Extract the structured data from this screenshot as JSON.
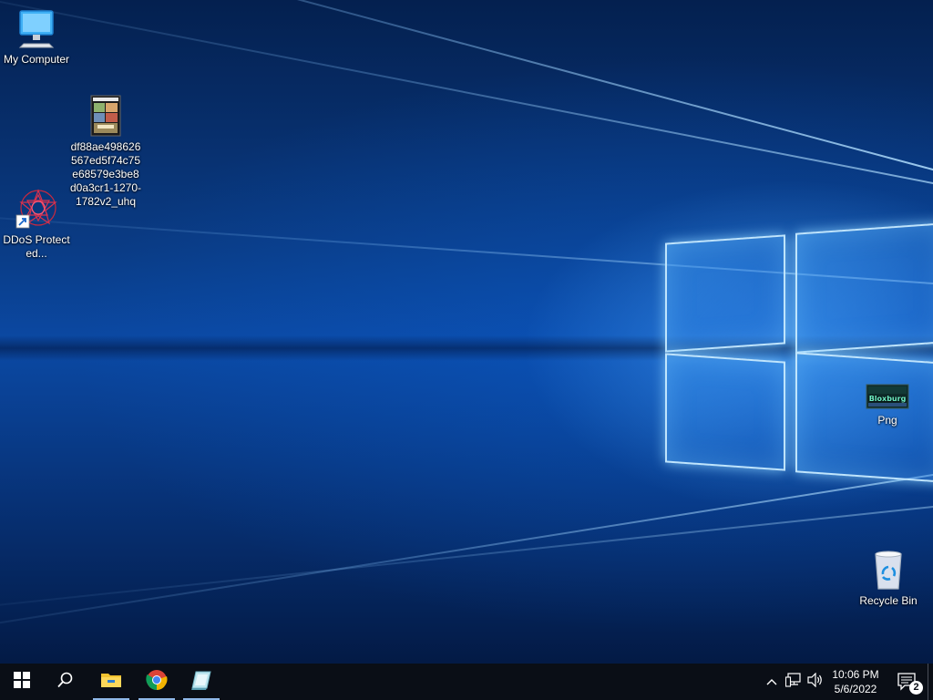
{
  "desktop": {
    "icons": {
      "my_computer": {
        "label": "My Computer",
        "icon": "monitor-icon"
      },
      "gta_file": {
        "label": "df88ae498626567ed5f74c75e68579e3be8d0a3cr1-1270-1782v2_uhq",
        "icon": "image-file-icon",
        "thumb_text": "PlayStation 2"
      },
      "ddos": {
        "label": "DDoS Protected...",
        "icon": "shortcut-app-icon"
      },
      "png": {
        "label": "Png",
        "icon": "image-file-icon",
        "thumb_text": "Bloxburg"
      },
      "recycle_bin": {
        "label": "Recycle Bin",
        "icon": "recycle-bin-icon"
      }
    }
  },
  "taskbar": {
    "start_icon": "windows-logo-icon",
    "search_icon": "search-icon",
    "pinned": [
      {
        "name": "File Explorer",
        "icon": "folder-icon",
        "active": true
      },
      {
        "name": "Google Chrome",
        "icon": "chrome-icon",
        "active": true
      },
      {
        "name": "App",
        "icon": "app-icon",
        "active": true
      }
    ],
    "tray": {
      "chevron_icon": "chevron-up-icon",
      "network_icon": "network-icon",
      "volume_icon": "volume-icon"
    },
    "clock": {
      "time": "10:06 PM",
      "date": "5/6/2022"
    },
    "notifications": {
      "icon": "action-center-icon",
      "count": "2"
    }
  },
  "colors": {
    "taskbar_bg": "#0a0e16",
    "accent": "#8fb8e8"
  }
}
